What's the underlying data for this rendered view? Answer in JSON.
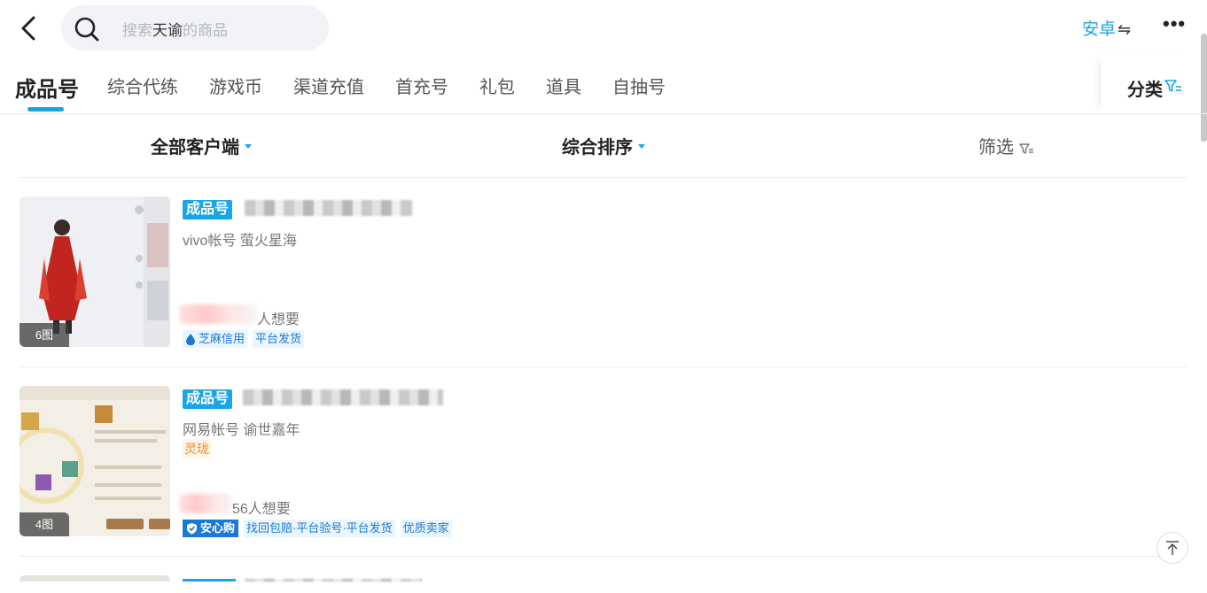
{
  "header": {
    "search": {
      "prefix": "搜索",
      "keyword": "天谕",
      "suffix": "的商品"
    },
    "platform_label": "安卓",
    "platform_swap": "⇋",
    "more": "•••"
  },
  "tabs": [
    {
      "label": "成品号",
      "active": true
    },
    {
      "label": "综合代练"
    },
    {
      "label": "游戏币"
    },
    {
      "label": "渠道充值"
    },
    {
      "label": "首充号"
    },
    {
      "label": "礼包"
    },
    {
      "label": "道具"
    },
    {
      "label": "自抽号"
    }
  ],
  "classify_label": "分类",
  "filters": {
    "client": "全部客户端",
    "sort": "综合排序",
    "screen": "筛选"
  },
  "listings": [
    {
      "image_count": "6图",
      "badge": "成品号",
      "sub": "vivo帐号 萤火星海",
      "want": "人想要",
      "tags": [
        "芝麻信用",
        "平台发货"
      ]
    },
    {
      "image_count": "4图",
      "badge": "成品号",
      "sub": "网易帐号 谕世嘉年",
      "special_tag": "灵珑",
      "want": "56人想要",
      "safe_tag": "安心购",
      "tags": [
        "找回包赔·平台验号·平台发货",
        "优质卖家"
      ]
    }
  ],
  "colors": {
    "accent": "#1aa6e6",
    "tag_blue": "#1b78d8",
    "orange": "#f08c1c"
  }
}
